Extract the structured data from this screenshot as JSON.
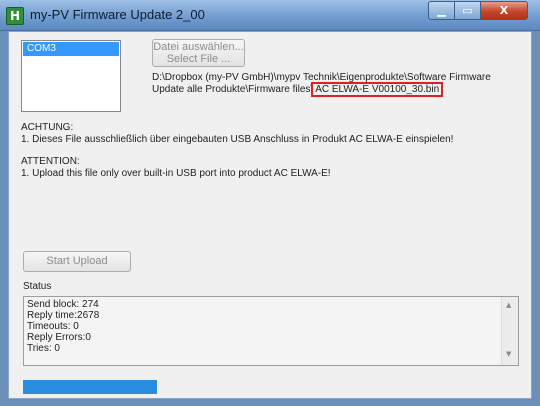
{
  "window": {
    "title": "my-PV Firmware Update 2_00",
    "app_icon_glyph": "H",
    "minimize_glyph": "▁",
    "maximize_glyph": "▭",
    "close_glyph": "X"
  },
  "ports": {
    "items": [
      "COM3"
    ],
    "selected": "COM3"
  },
  "select_button": {
    "line1": "Datei auswählen...",
    "line2": "Select File ..."
  },
  "file_path": {
    "prefix": "D:\\Dropbox (my-PV GmbH)\\mypv Technik\\Eigenprodukte\\Software Firmware Update alle Produkte\\Firmware files\\",
    "filename": "AC ELWA-E V00100_30.bin"
  },
  "notice_de": {
    "heading": "ACHTUNG:",
    "text": "1. Dieses File ausschließlich über eingebauten USB Anschluss in Produkt AC ELWA-E einspielen!"
  },
  "notice_en": {
    "heading": "ATTENTION:",
    "text": "1. Upload this file only over built-in USB port into product AC ELWA-E!"
  },
  "start_upload_label": "Start Upload",
  "status": {
    "label": "Status",
    "lines": [
      "Send block: 274",
      "Reply time:2678",
      "Timeouts: 0",
      "Reply Errors:0",
      "Tries: 0"
    ]
  },
  "progress": {
    "fraction": 0.27
  },
  "colors": {
    "accent_selection": "#3399ff",
    "highlight_border": "#e02020",
    "progress_fill": "#2a8de0"
  }
}
